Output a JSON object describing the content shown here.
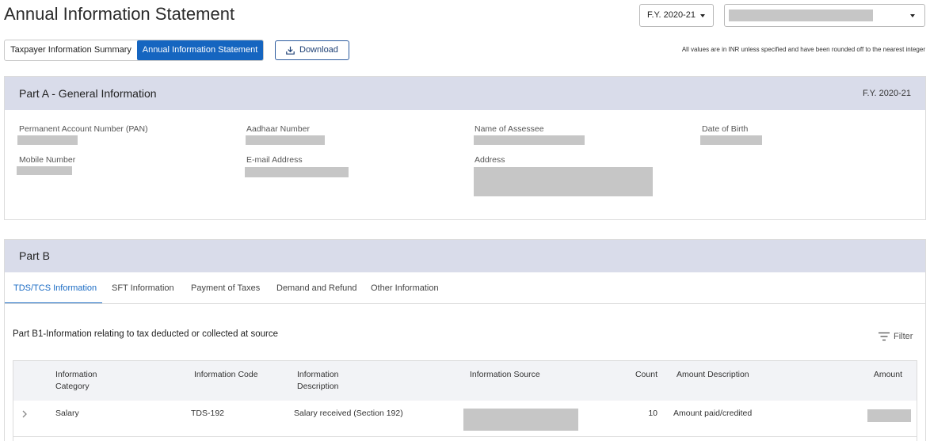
{
  "header": {
    "title": "Annual Information Statement",
    "fy_select": "F.Y. 2020-21"
  },
  "view_toggle": {
    "summary": "Taxpayer Information Summary",
    "statement": "Annual Information Statement",
    "statement_active": true
  },
  "toolbar": {
    "download_label": "Download",
    "download_icon": "download-icon"
  },
  "note": "All values are in INR unless specified and have been rounded off to the nearest integer",
  "part_a": {
    "title": "Part A - General Information",
    "fy": "F.Y. 2020-21",
    "fields": [
      {
        "label": "Permanent Account Number (PAN)"
      },
      {
        "label": "Aadhaar Number"
      },
      {
        "label": "Name of Assessee"
      },
      {
        "label": "Date of Birth"
      },
      {
        "label": "Mobile Number"
      },
      {
        "label": "E-mail Address"
      },
      {
        "label": "Address"
      }
    ]
  },
  "part_b": {
    "title": "Part B",
    "tabs": [
      {
        "label": "TDS/TCS Information",
        "active": true
      },
      {
        "label": "SFT Information",
        "active": false
      },
      {
        "label": "Payment of Taxes",
        "active": false
      },
      {
        "label": "Demand and Refund",
        "active": false
      },
      {
        "label": "Other Information",
        "active": false
      }
    ],
    "section_title": "Part B1-Information relating to tax deducted or collected at source",
    "filter": {
      "label": "Filter",
      "icon": "filter-icon"
    },
    "table": {
      "headers": [
        "Information Category",
        "Information Code",
        "Information Description",
        "Information Source",
        "Count",
        "Amount Description",
        "Amount"
      ],
      "rows": [
        {
          "expand_icon": "chevron-right-icon",
          "category": "Salary",
          "code": "TDS-192",
          "description": "Salary received (Section 192)",
          "count": "10",
          "amount_description": "Amount paid/credited"
        }
      ]
    }
  },
  "colors": {
    "accent": "#1565c0",
    "section_header_bg": "#d9dcea",
    "table_header_bg": "#f2f3f6",
    "redacted": "#c6c6c6"
  }
}
